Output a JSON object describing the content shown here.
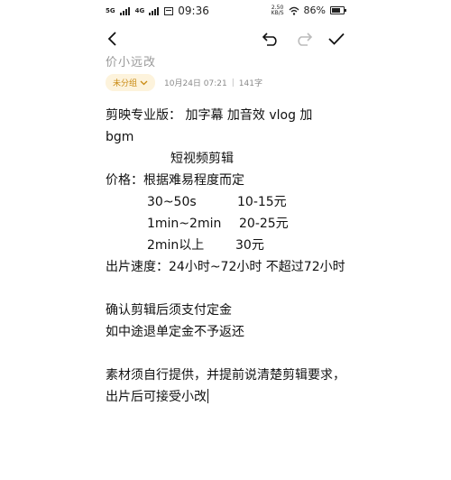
{
  "status_bar": {
    "signal1": "5G",
    "signal2": "4G",
    "time": "09:36",
    "speed_value": "2.50",
    "speed_unit": "KB/S",
    "battery": "86%"
  },
  "note": {
    "title": "价小远改",
    "category": "未分组",
    "date": "10月24日 07:21",
    "word_count": "141字"
  },
  "content": {
    "l1": "剪映专业版：  加字幕   加音效   vlog   加",
    "l2": "bgm",
    "l3": "短视频剪辑",
    "l4": "价格：根据难易程度而定",
    "price_rows": [
      {
        "duration": "30~50s",
        "price": "10-15元"
      },
      {
        "duration": "1min~2min",
        "price": "20-25元"
      },
      {
        "duration": "2min以上",
        "price": "30元"
      }
    ],
    "l8": "出片速度：24小时~72小时  不超过72小时",
    "l10": "确认剪辑后须支付定金",
    "l11": "如中途退单定金不予返还",
    "l13": "素材须自行提供，并提前说清楚剪辑要求，",
    "l14": "出片后可接受小改"
  },
  "icons": {
    "back": "back-arrow-icon",
    "undo": "undo-icon",
    "redo": "redo-icon",
    "confirm": "checkmark-icon",
    "category_dropdown": "chevron-down-icon",
    "wifi": "wifi-icon",
    "battery": "battery-icon"
  },
  "colors": {
    "category_chip_bg": "#fdf3dc",
    "category_chip_text": "#c98a12",
    "meta_text": "#8a8a8a",
    "redo_disabled": "#bbbbbb"
  }
}
